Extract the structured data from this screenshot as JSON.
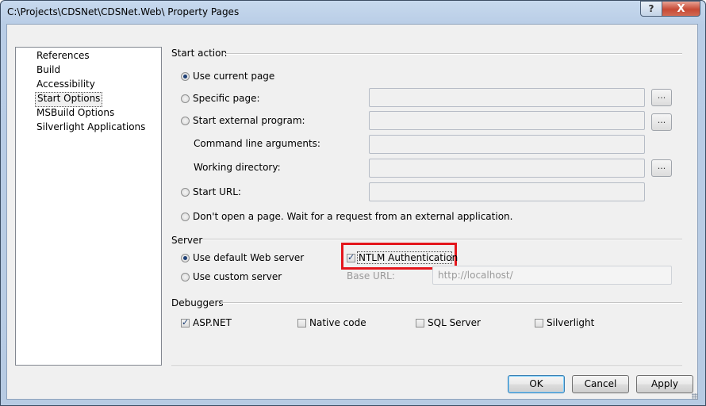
{
  "window": {
    "title": "C:\\Projects\\CDSNet\\CDSNet.Web\\ Property Pages",
    "help_label": "?",
    "close_label": "X"
  },
  "sidebar": {
    "items": [
      {
        "label": "References"
      },
      {
        "label": "Build"
      },
      {
        "label": "Accessibility"
      },
      {
        "label": "Start Options",
        "selected": true
      },
      {
        "label": "MSBuild Options"
      },
      {
        "label": "Silverlight Applications"
      }
    ]
  },
  "start_action": {
    "group_label": "Start action",
    "use_current_page": "Use current page",
    "specific_page": "Specific page:",
    "start_external_program": "Start external program:",
    "command_line_arguments": "Command line arguments:",
    "working_directory": "Working directory:",
    "start_url": "Start URL:",
    "dont_open_page": "Don't open a page. Wait for a request from an external application.",
    "browse_label": "...",
    "selected": "Use current page"
  },
  "server": {
    "group_label": "Server",
    "use_default_web_server": "Use default Web server",
    "use_custom_server": "Use custom server",
    "ntlm_authentication": "NTLM Authentication",
    "ntlm_checked": true,
    "base_url_label": "Base URL:",
    "base_url_value": "http://localhost/",
    "selected": "Use default Web server"
  },
  "debuggers": {
    "group_label": "Debuggers",
    "items": [
      {
        "label": "ASP.NET",
        "checked": true
      },
      {
        "label": "Native code",
        "checked": false
      },
      {
        "label": "SQL Server",
        "checked": false
      },
      {
        "label": "Silverlight",
        "checked": false
      }
    ]
  },
  "buttons": {
    "ok": "OK",
    "cancel": "Cancel",
    "apply": "Apply"
  },
  "colors": {
    "highlight_box": "#e4161c",
    "selected_indicator": "#1d3f75"
  }
}
